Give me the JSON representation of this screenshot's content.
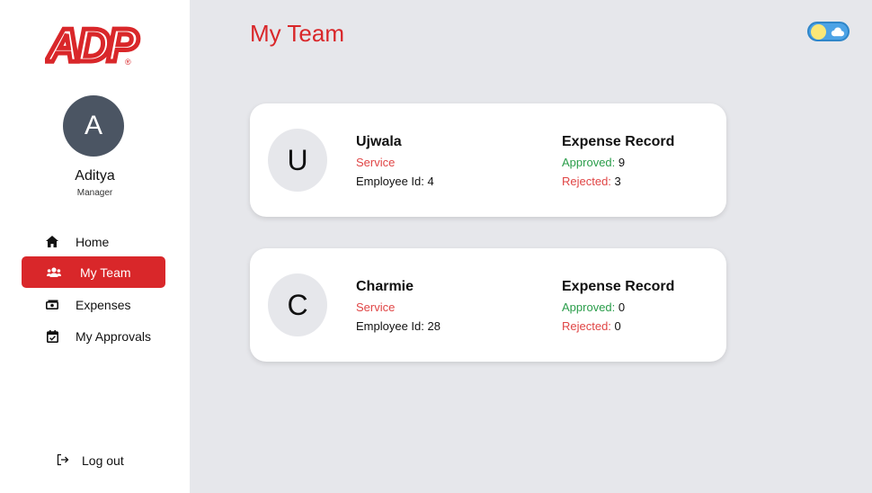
{
  "brand": {
    "logo_text": "ADP",
    "registered_mark": "®",
    "brand_color": "#d9272a"
  },
  "user": {
    "initial": "A",
    "name": "Aditya",
    "role": "Manager"
  },
  "nav": {
    "items": [
      {
        "label": "Home",
        "icon": "home-icon"
      },
      {
        "label": "My Team",
        "icon": "team-icon",
        "active": true
      },
      {
        "label": "Expenses",
        "icon": "money-icon"
      },
      {
        "label": "My Approvals",
        "icon": "calendar-check-icon"
      }
    ],
    "logout_label": "Log out"
  },
  "header": {
    "title": "My Team",
    "theme_toggle": "light"
  },
  "team": [
    {
      "initial": "U",
      "name": "Ujwala",
      "department": "Service",
      "employee_id_label": "Employee Id: 4",
      "record_title": "Expense Record",
      "approved_label": "Approved:",
      "approved": "9",
      "rejected_label": "Rejected:",
      "rejected": "3"
    },
    {
      "initial": "C",
      "name": "Charmie",
      "department": "Service",
      "employee_id_label": "Employee Id: 28",
      "record_title": "Expense Record",
      "approved_label": "Approved:",
      "approved": "0",
      "rejected_label": "Rejected:",
      "rejected": "0"
    }
  ]
}
